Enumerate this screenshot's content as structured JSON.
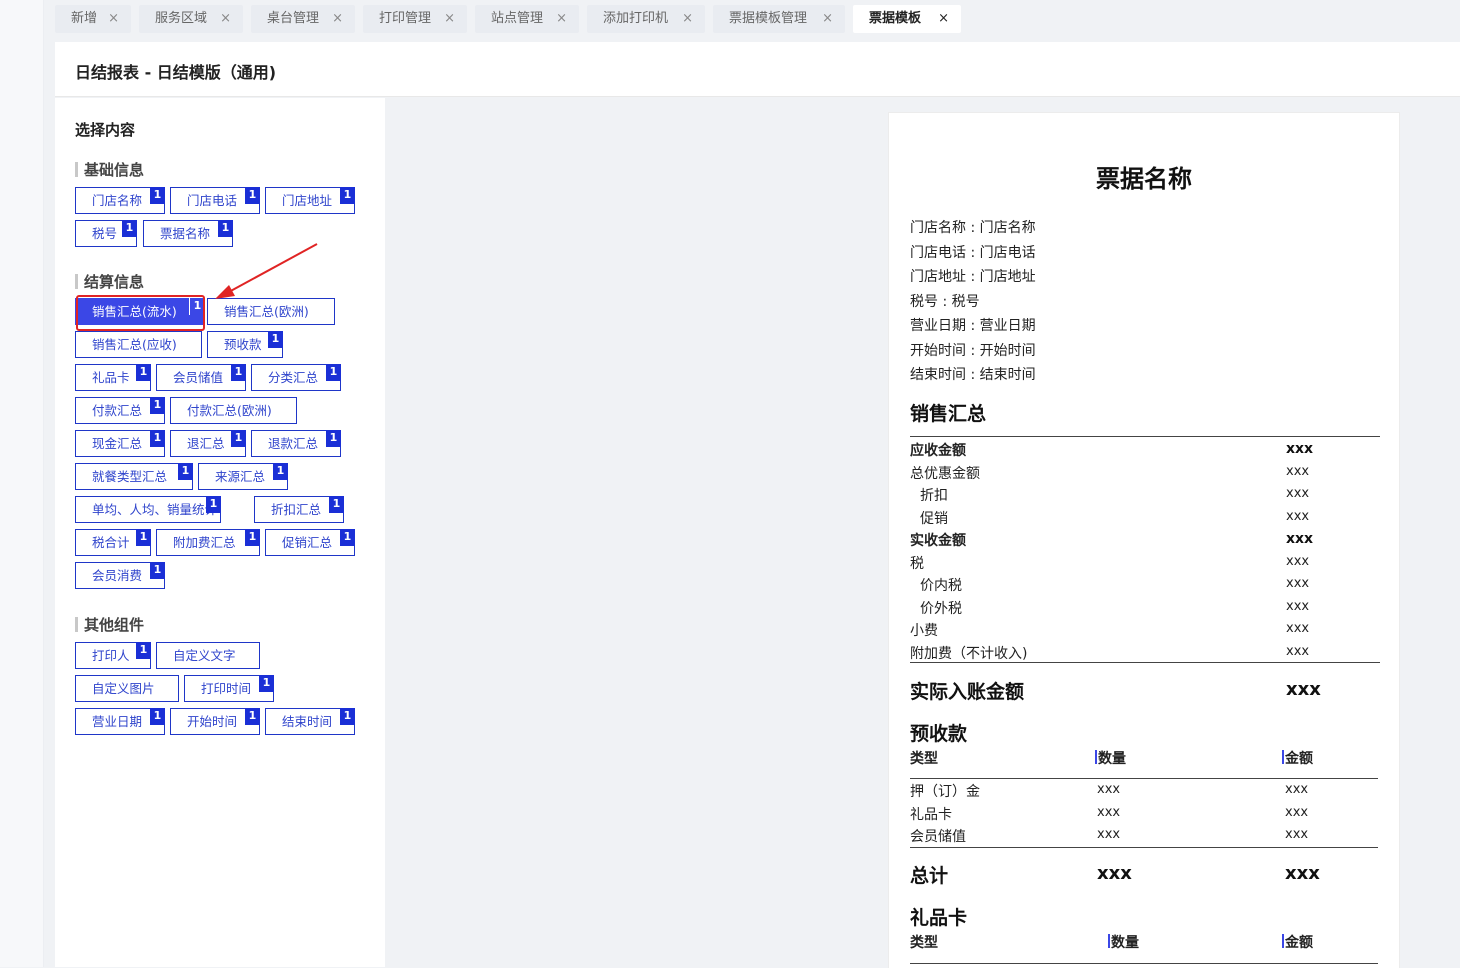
{
  "tabs": [
    {
      "label": "新增"
    },
    {
      "label": "服务区域"
    },
    {
      "label": "桌台管理"
    },
    {
      "label": "打印管理"
    },
    {
      "label": "站点管理"
    },
    {
      "label": "添加打印机"
    },
    {
      "label": "票据模板管理"
    },
    {
      "label": "票据模板",
      "active": true
    }
  ],
  "tab_close_glyph": "×",
  "header": {
    "title": "日结报表 - 日结模版（通用)"
  },
  "left": {
    "title": "选择内容",
    "sections": [
      {
        "title": "基础信息"
      },
      {
        "title": "结算信息"
      },
      {
        "title": "其他组件"
      }
    ],
    "chips": [
      {
        "label": "门店名称",
        "badge": "1"
      },
      {
        "label": "门店电话",
        "badge": "1"
      },
      {
        "label": "门店地址",
        "badge": "1"
      },
      {
        "label": "税号",
        "badge": "1"
      },
      {
        "label": "票据名称",
        "badge": "1"
      },
      {
        "label": "销售汇总(流水)",
        "badge": "1",
        "selected": true
      },
      {
        "label": "销售汇总(欧洲)",
        "badge": ""
      },
      {
        "label": "销售汇总(应收)",
        "badge": ""
      },
      {
        "label": "预收款",
        "badge": "1"
      },
      {
        "label": "礼品卡",
        "badge": "1"
      },
      {
        "label": "会员储值",
        "badge": "1"
      },
      {
        "label": "分类汇总",
        "badge": "1"
      },
      {
        "label": "付款汇总",
        "badge": "1"
      },
      {
        "label": "付款汇总(欧洲)",
        "badge": ""
      },
      {
        "label": "现金汇总",
        "badge": "1"
      },
      {
        "label": "退汇总",
        "badge": "1"
      },
      {
        "label": "退款汇总",
        "badge": "1"
      },
      {
        "label": "就餐类型汇总",
        "badge": "1"
      },
      {
        "label": "来源汇总",
        "badge": "1"
      },
      {
        "label": "单均、人均、销量统计",
        "badge": "1"
      },
      {
        "label": "折扣汇总",
        "badge": "1"
      },
      {
        "label": "税合计",
        "badge": "1"
      },
      {
        "label": "附加费汇总",
        "badge": "1"
      },
      {
        "label": "促销汇总",
        "badge": "1"
      },
      {
        "label": "会员消费",
        "badge": "1"
      },
      {
        "label": "打印人",
        "badge": "1"
      },
      {
        "label": "自定义文字",
        "badge": ""
      },
      {
        "label": "自定义图片",
        "badge": ""
      },
      {
        "label": "打印时间",
        "badge": "1"
      },
      {
        "label": "营业日期",
        "badge": "1"
      },
      {
        "label": "开始时间",
        "badge": "1"
      },
      {
        "label": "结束时间",
        "badge": "1"
      }
    ]
  },
  "preview": {
    "title": "票据名称",
    "info": [
      "门店名称 : 门店名称",
      "门店电话 : 门店电话",
      "门店地址 : 门店地址",
      "税号 : 税号",
      "营业日期 : 营业日期",
      "开始时间 : 开始时间",
      "结束时间 : 结束时间"
    ],
    "sales": {
      "title": "销售汇总",
      "rows": [
        {
          "label": "应收金额",
          "value": "xxx",
          "bold": true
        },
        {
          "label": "总优惠金额",
          "value": "xxx"
        },
        {
          "label": "折扣",
          "value": "xxx",
          "indent": true
        },
        {
          "label": "促销",
          "value": "xxx",
          "indent": true
        },
        {
          "label": "实收金额",
          "value": "xxx",
          "bold": true
        },
        {
          "label": "税",
          "value": "xxx"
        },
        {
          "label": "价内税",
          "value": "xxx",
          "indent": true
        },
        {
          "label": "价外税",
          "value": "xxx",
          "indent": true
        },
        {
          "label": "小费",
          "value": "xxx"
        },
        {
          "label": "附加费（不计收入)",
          "value": "xxx"
        }
      ],
      "total_label": "实际入账金额",
      "total_value": "xxx"
    },
    "prepaid": {
      "title": "预收款",
      "cols": [
        "类型",
        "数量",
        "金额"
      ],
      "rows": [
        {
          "type": "押（订）金",
          "qty": "xxx",
          "amt": "xxx"
        },
        {
          "type": "礼品卡",
          "qty": "xxx",
          "amt": "xxx"
        },
        {
          "type": "会员储值",
          "qty": "xxx",
          "amt": "xxx"
        }
      ],
      "total_label": "总计",
      "total_qty": "xxx",
      "total_amt": "xxx"
    },
    "giftcard": {
      "title": "礼品卡",
      "cols": [
        "类型",
        "数量",
        "金额"
      ]
    }
  },
  "colors": {
    "accent": "#3b47e6",
    "chip_border": "#1f36c8",
    "annotation": "#e02424"
  }
}
